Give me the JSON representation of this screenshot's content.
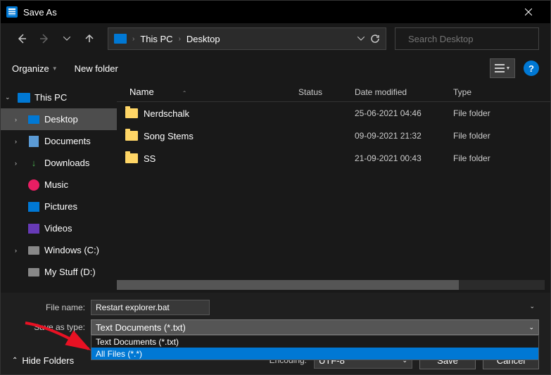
{
  "title": "Save As",
  "breadcrumb": {
    "root": "This PC",
    "current": "Desktop"
  },
  "search": {
    "placeholder": "Search Desktop"
  },
  "toolbar": {
    "organize": "Organize",
    "new_folder": "New folder"
  },
  "sidebar": {
    "root": "This PC",
    "items": [
      {
        "label": "Desktop"
      },
      {
        "label": "Documents"
      },
      {
        "label": "Downloads"
      },
      {
        "label": "Music"
      },
      {
        "label": "Pictures"
      },
      {
        "label": "Videos"
      },
      {
        "label": "Windows (C:)"
      },
      {
        "label": "My Stuff (D:)"
      }
    ]
  },
  "columns": {
    "name": "Name",
    "status": "Status",
    "date": "Date modified",
    "type": "Type"
  },
  "files": [
    {
      "name": "Nerdschalk",
      "date": "25-06-2021 04:46",
      "type": "File folder"
    },
    {
      "name": "Song Stems",
      "date": "09-09-2021 21:32",
      "type": "File folder"
    },
    {
      "name": "SS",
      "date": "21-09-2021 00:43",
      "type": "File folder"
    }
  ],
  "form": {
    "filename_label": "File name:",
    "filename_value": "Restart explorer.bat",
    "type_label": "Save as type:",
    "type_value": "Text Documents (*.txt)",
    "options": [
      {
        "label": "Text Documents (*.txt)"
      },
      {
        "label": "All Files  (*.*)"
      }
    ]
  },
  "footer": {
    "hide": "Hide Folders",
    "encoding_label": "Encoding:",
    "encoding_value": "UTF-8",
    "save": "Save",
    "cancel": "Cancel"
  },
  "help": "?"
}
